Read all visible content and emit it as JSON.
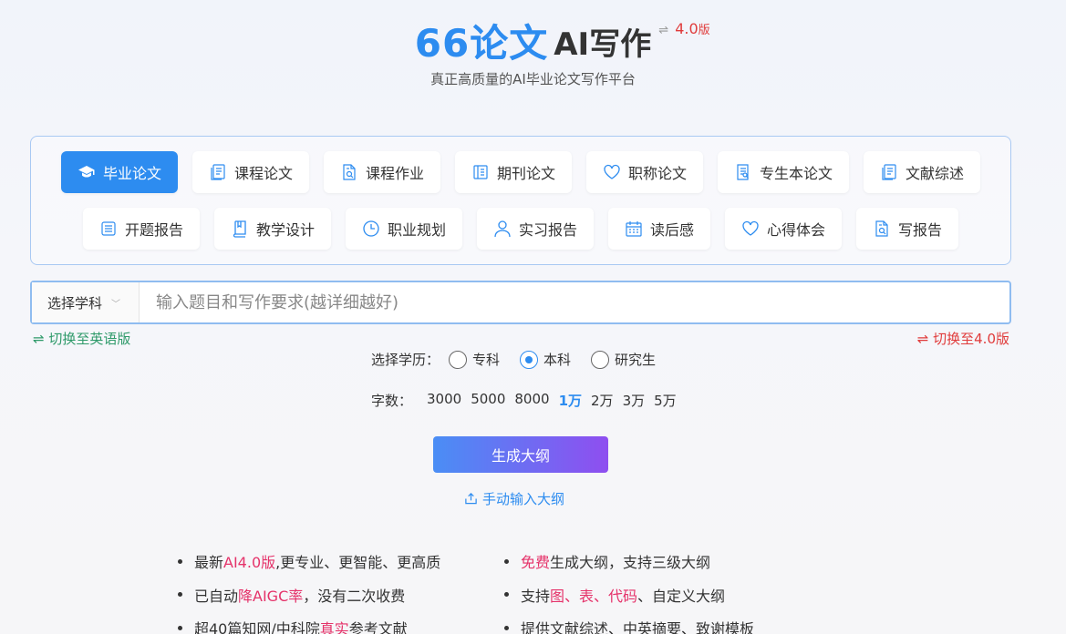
{
  "header": {
    "logo_main": "66论文",
    "logo_sub": "AI写作",
    "version_icon": "⇌",
    "version": "4.0",
    "version_suffix": "版",
    "tagline": "真正高质量的AI毕业论文写作平台"
  },
  "paper_types": {
    "row1": [
      {
        "label": "毕业论文",
        "icon": "graduation-cap-icon",
        "active": true
      },
      {
        "label": "课程论文",
        "icon": "document-copy-icon"
      },
      {
        "label": "课程作业",
        "icon": "document-search-icon"
      },
      {
        "label": "期刊论文",
        "icon": "journal-icon"
      },
      {
        "label": "职称论文",
        "icon": "heart-icon"
      },
      {
        "label": "专生本论文",
        "icon": "document-edit-icon"
      },
      {
        "label": "文献综述",
        "icon": "document-copy-icon"
      }
    ],
    "row2": [
      {
        "label": "开题报告",
        "icon": "report-icon"
      },
      {
        "label": "教学设计",
        "icon": "book-icon"
      },
      {
        "label": "职业规划",
        "icon": "clock-icon"
      },
      {
        "label": "实习报告",
        "icon": "user-icon"
      },
      {
        "label": "读后感",
        "icon": "calendar-icon"
      },
      {
        "label": "心得体会",
        "icon": "heart-icon"
      },
      {
        "label": "写报告",
        "icon": "document-search-icon"
      }
    ]
  },
  "search": {
    "subject_label": "选择学科",
    "placeholder": "输入题目和写作要求(越详细越好)",
    "value": ""
  },
  "switches": {
    "english": "⇌ 切换至英语版",
    "v40": "⇌ 切换至4.0版"
  },
  "education": {
    "label": "选择学历：",
    "options": [
      {
        "label": "专科",
        "checked": false
      },
      {
        "label": "本科",
        "checked": true
      },
      {
        "label": "研究生",
        "checked": false
      }
    ]
  },
  "word_count": {
    "label": "字数：",
    "options": [
      "3000",
      "5000",
      "8000",
      "1万",
      "2万",
      "3万",
      "5万"
    ],
    "selected": "1万"
  },
  "actions": {
    "generate": "生成大纲",
    "manual": "手动输入大纲"
  },
  "features": {
    "left": [
      {
        "parts": [
          {
            "t": "最新"
          },
          {
            "t": "AI4.0版",
            "hl": true
          },
          {
            "t": ",更专业、更智能、更高质"
          }
        ]
      },
      {
        "parts": [
          {
            "t": "已自动"
          },
          {
            "t": "降AIGC率",
            "hl": true
          },
          {
            "t": "，没有二次收费"
          }
        ]
      },
      {
        "parts": [
          {
            "t": "超40篇知网/中科院"
          },
          {
            "t": "真实",
            "hl": true
          },
          {
            "t": "参考文献"
          }
        ]
      }
    ],
    "right": [
      {
        "parts": [
          {
            "t": "免费",
            "hl": true
          },
          {
            "t": "生成大纲，支持三级大纲"
          }
        ]
      },
      {
        "parts": [
          {
            "t": "支持"
          },
          {
            "t": "图、表、代码",
            "hl": true
          },
          {
            "t": "、自定义大纲"
          }
        ]
      },
      {
        "parts": [
          {
            "t": "提供文献综述、中英摘要、致谢模板"
          }
        ]
      }
    ]
  },
  "colors": {
    "brand": "#2d8cf0",
    "highlight": "#e5336a",
    "switch_en": "#2e9a6a",
    "switch_40": "#e03b3b"
  }
}
